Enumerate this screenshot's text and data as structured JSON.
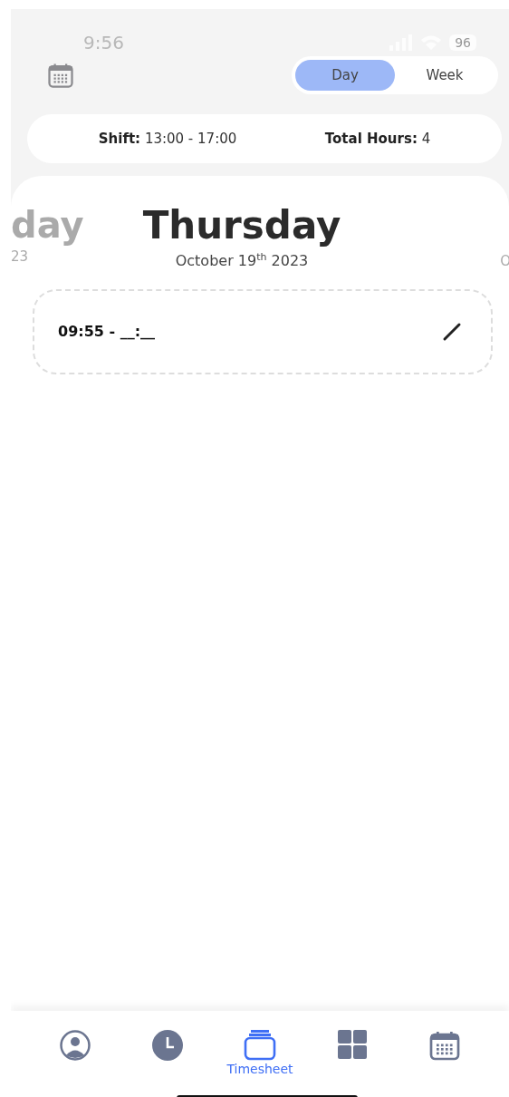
{
  "status_bar": {
    "time": "9:56",
    "battery": "96"
  },
  "view_toggle": [
    {
      "label": "Day",
      "selected": true
    },
    {
      "label": "Week",
      "selected": false
    }
  ],
  "summary": [
    {
      "label": "Shift:",
      "value": "13:00 - 17:00"
    },
    {
      "label": "Total Hours:",
      "value": "4"
    }
  ],
  "day_carousel": {
    "previous": {
      "day": "day",
      "date": "23"
    },
    "current": {
      "day": "Thursday",
      "date": "October 19$^{th}$ 2023"
    },
    "next": {
      "date": "O"
    }
  },
  "entries": [
    {
      "time": "09:55 - __:__"
    }
  ],
  "bottom_nav": [
    {
      "selected": false
    },
    {
      "selected": false
    },
    {
      "selected": true,
      "label": "Timesheet"
    },
    {
      "selected": false
    },
    {
      "selected": false
    }
  ]
}
